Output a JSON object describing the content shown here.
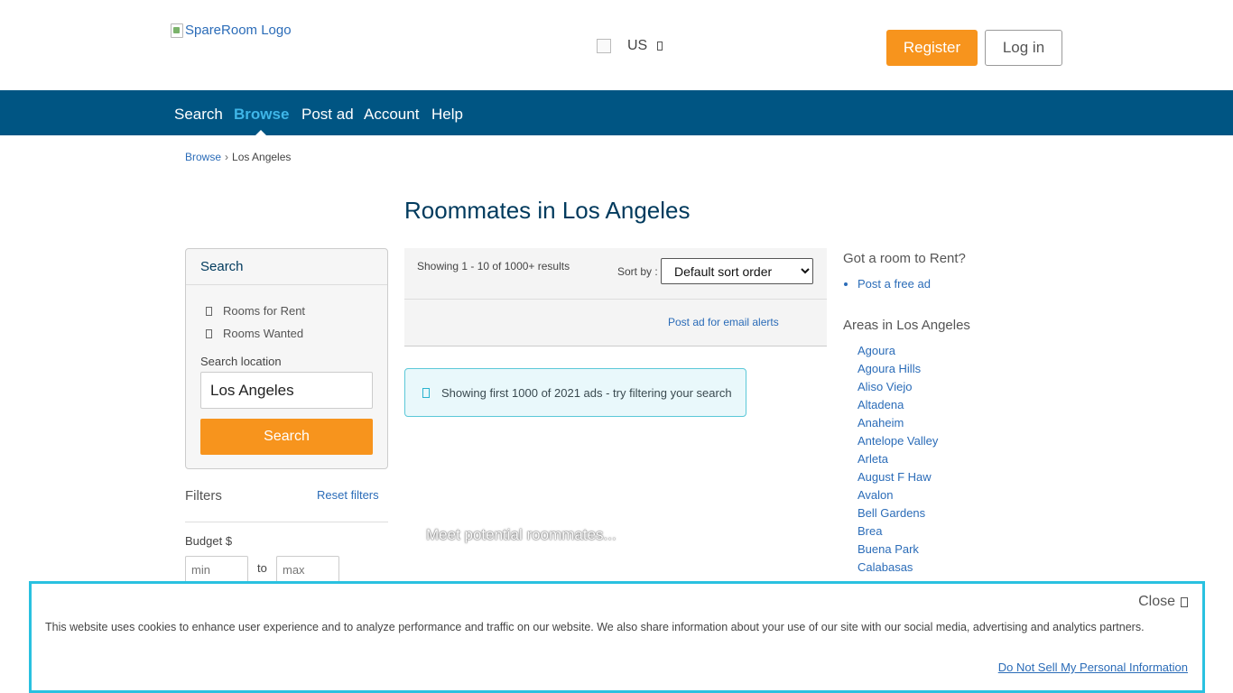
{
  "header": {
    "logo_alt": "SpareRoom Logo",
    "locale": "US",
    "register_label": "Register",
    "login_label": "Log in"
  },
  "nav": {
    "items": [
      "Search",
      "Browse",
      "Post ad",
      "Account",
      "Help"
    ],
    "active": "Browse"
  },
  "breadcrumb": {
    "root": "Browse",
    "current": "Los Angeles"
  },
  "page_title": "Roommates in Los Angeles",
  "search_panel": {
    "title": "Search",
    "options": [
      "Rooms for Rent",
      "Rooms Wanted"
    ],
    "location_label": "Search location",
    "location_value": "Los Angeles",
    "search_button": "Search"
  },
  "filters": {
    "title": "Filters",
    "reset_label": "Reset filters",
    "budget_label": "Budget $",
    "min_placeholder": "min",
    "max_placeholder": "max",
    "to_label": "to"
  },
  "results": {
    "count_text": "Showing 1 - 10 of 1000+ results",
    "sort_label": "Sort by :",
    "sort_value": "Default sort order",
    "alerts_link": "Post ad for email alerts",
    "info_message": "Showing first 1000 of 2021 ads - try filtering your search",
    "loading_text": "Meet potential roommates..."
  },
  "sidebar": {
    "rent_title": "Got a room to Rent?",
    "post_free_ad": "Post a free ad",
    "areas_title": "Areas in Los Angeles",
    "areas": [
      "Agoura",
      "Agoura Hills",
      "Aliso Viejo",
      "Altadena",
      "Anaheim",
      "Antelope Valley",
      "Arleta",
      "August F Haw",
      "Avalon",
      "Bell Gardens",
      "Brea",
      "Buena Park",
      "Calabasas"
    ]
  },
  "cookie_banner": {
    "close_label": "Close",
    "message": "This website uses cookies to enhance user experience and to analyze performance and traffic on our website. We also share information about your use of our site with our social media, advertising and analytics partners.",
    "dns_link": "Do Not Sell My Personal Information"
  },
  "colors": {
    "nav_bg": "#005583",
    "accent_orange": "#f7941d",
    "link_blue": "#2b6cb8",
    "active_nav": "#3fb6e8",
    "cookie_border": "#29c1e0"
  }
}
